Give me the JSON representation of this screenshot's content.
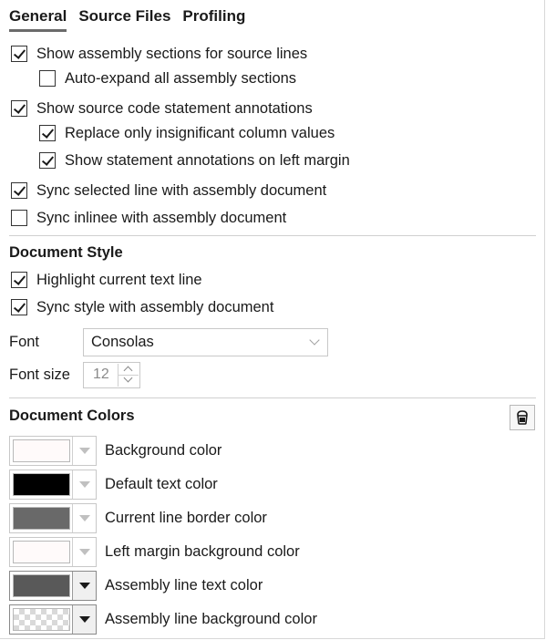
{
  "tabs": [
    {
      "label": "General",
      "active": true
    },
    {
      "label": "Source Files",
      "active": false
    },
    {
      "label": "Profiling",
      "active": false
    }
  ],
  "general_options": [
    {
      "label": "Show assembly sections for source lines",
      "checked": true
    },
    {
      "label": "Auto-expand all assembly sections",
      "checked": false
    },
    {
      "label": "Show source code statement annotations",
      "checked": true
    },
    {
      "label": "Replace only insignificant column values",
      "checked": true
    },
    {
      "label": "Show statement annotations on left margin",
      "checked": true
    },
    {
      "label": "Sync selected line with assembly document",
      "checked": true
    },
    {
      "label": "Sync inlinee with assembly document",
      "checked": false
    }
  ],
  "document_style": {
    "title": "Document Style",
    "options": [
      {
        "label": "Highlight current text line",
        "checked": true
      },
      {
        "label": "Sync style with assembly document",
        "checked": true
      }
    ],
    "font_label": "Font",
    "font_value": "Consolas",
    "font_size_label": "Font size",
    "font_size_value": "12"
  },
  "document_colors": {
    "title": "Document Colors",
    "reset_icon": "paint-bucket-icon",
    "items": [
      {
        "label": "Background color",
        "color": "#fffafa",
        "enabled": false
      },
      {
        "label": "Default text color",
        "color": "#000000",
        "enabled": false
      },
      {
        "label": "Current line border color",
        "color": "#696969",
        "enabled": false
      },
      {
        "label": "Left margin background color",
        "color": "#fffafa",
        "enabled": false
      },
      {
        "label": "Assembly line text color",
        "color": "#595959",
        "enabled": true
      },
      {
        "label": "Assembly line background color",
        "color": "transparent",
        "enabled": true
      }
    ]
  }
}
